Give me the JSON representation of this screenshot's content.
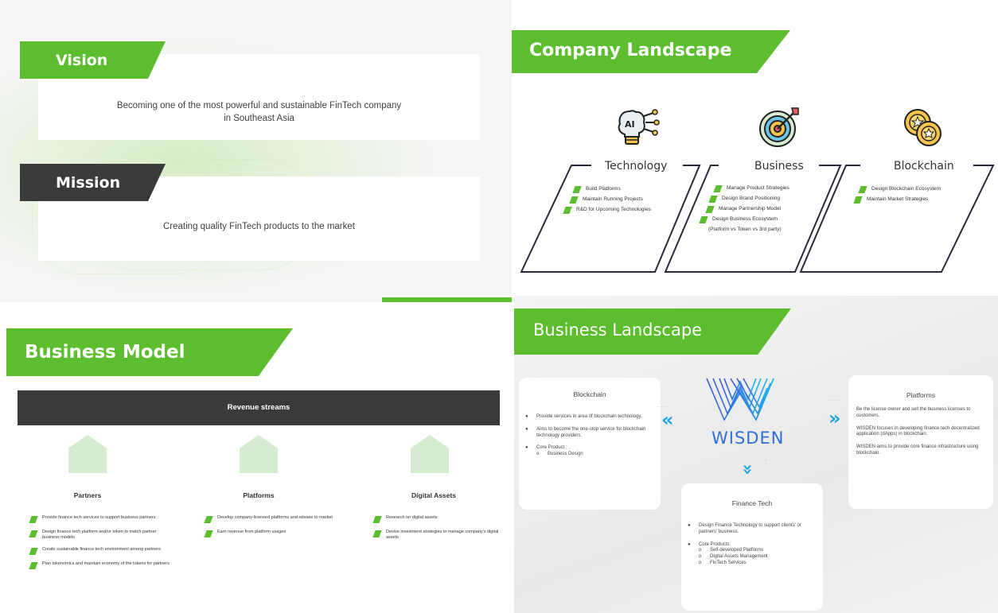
{
  "vision_panel": {
    "vision_title": "Vision",
    "vision_text_line1": "Becoming one of the most powerful and sustainable FinTech company",
    "vision_text_line2": "in Southeast Asia",
    "mission_title": "Mission",
    "mission_text": "Creating quality FinTech products to the market"
  },
  "company_landscape": {
    "title": "Company Landscape",
    "columns": [
      {
        "name": "Technology",
        "icon": "ai-brain-icon",
        "items": [
          "Build Platforms",
          "Maintain Running Projects",
          "R&D for Upcoming Technologies"
        ]
      },
      {
        "name": "Business",
        "icon": "target-icon",
        "items": [
          "Manage Product Strategies",
          "Design Brand Positioning",
          "Manage Partnership Model",
          "Design Business Ecosystem"
        ],
        "note": "(Platform vs Token vs 3rd party)"
      },
      {
        "name": "Blockchain",
        "icon": "coins-icon",
        "items": [
          "Design Blockchain Ecosystem",
          "Maintain Market Strategies"
        ]
      }
    ]
  },
  "business_model": {
    "title": "Business Model",
    "bar_label": "Revenue streams",
    "columns": [
      {
        "name": "Partners",
        "items": [
          "Provide finance tech services to support business partners",
          "Design finance tech platform and/or token to match partner business models",
          "Create sustainable finance tech environment among partners",
          "Plan tokenomics and maintain economy of the tokens for partners"
        ]
      },
      {
        "name": "Platforms",
        "items": [
          "Develop company-licensed platforms and release to market",
          "Earn revenue from platform usages"
        ]
      },
      {
        "name": "Digital Assets",
        "items": [
          "Research on digital assets",
          "Devise investment strategies to manage company's digital assets"
        ]
      }
    ]
  },
  "business_landscape": {
    "title": "Business Landscape",
    "logo_text": "WISDEN",
    "blockchain": {
      "title": "Blockchain",
      "items": [
        "Provide services in area of blockchain technology.",
        "Aims to become the one-stop service for blockchain technology providers.",
        "Core Product :"
      ],
      "sub": [
        "Business Design"
      ]
    },
    "platforms": {
      "title": "Platforms",
      "paragraphs": [
        "Be the license owner and sell the business licenses to customers.",
        "WISDEN focuses in developing finance tech decentralized application (dApps) in blockchain.",
        "WISDEN aims to provide core finance infrastructure using blockchain."
      ]
    },
    "finance_tech": {
      "title": "Finance Tech",
      "items": [
        "Design Finance Technology to support clients' or partners' business.",
        "Core Products:"
      ],
      "sub": [
        "Self-developed Platforms",
        "Digital Assets Management",
        "FinTech Services"
      ]
    },
    "colors": {
      "accent_green": "#5cbd2e",
      "chevron_blue": "#1fa8e0",
      "logo_blue": "#2f6fd6"
    }
  }
}
